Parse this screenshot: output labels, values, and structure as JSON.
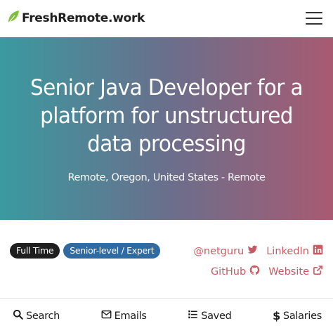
{
  "header": {
    "brand": "FreshRemote.work",
    "brand_icon": "leaf-icon",
    "menu_icon": "hamburger-menu-icon"
  },
  "job": {
    "title": "Senior Java Developer for a platform for unstructured data processing",
    "location": "Remote, Oregon, United States - Remote"
  },
  "tags": [
    "Full Time",
    "Senior-level / Expert"
  ],
  "company_links": {
    "twitter": "@netguru",
    "linkedin": "LinkedIn",
    "github": "GitHub",
    "website": "Website"
  },
  "bottom_nav": {
    "search": "Search",
    "emails": "Emails",
    "saved": "Saved",
    "salaries": "Salaries"
  },
  "colors": {
    "hero_start": "#3a9aa0",
    "hero_end": "#a85a72",
    "link": "#c85a63",
    "tag_dark": "#1f1f1f",
    "tag_blue": "#2f6aa3",
    "brand_leaf": "#7cbf3a"
  }
}
